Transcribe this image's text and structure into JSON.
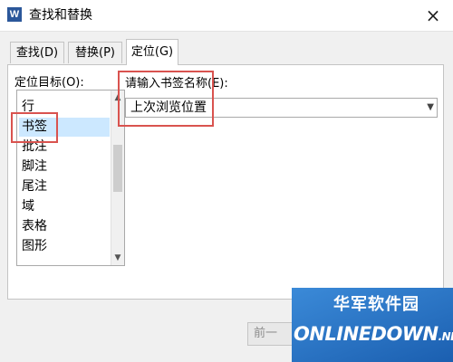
{
  "window": {
    "title": "查找和替换",
    "app_icon_letter": "W",
    "close_glyph": "×"
  },
  "tabs": [
    {
      "label": "查找(D)"
    },
    {
      "label": "替换(P)"
    },
    {
      "label": "定位(G)"
    }
  ],
  "goto": {
    "target_label": "定位目标(O):",
    "targets": [
      "行",
      "书签",
      "批注",
      "脚注",
      "尾注",
      "域",
      "表格",
      "图形"
    ],
    "selected_target": "书签",
    "bookmark_label": "请输入书签名称(E):",
    "bookmark_value": "上次浏览位置"
  },
  "buttons": {
    "prev": "前一"
  },
  "watermark": {
    "cn_text": "华军软件园",
    "en_text": "ONLINEDOWN",
    "en_suffix": ".NET"
  },
  "colors": {
    "highlight": "#d9534f",
    "selection": "#cce8ff",
    "watermark": "#2a73c5"
  }
}
